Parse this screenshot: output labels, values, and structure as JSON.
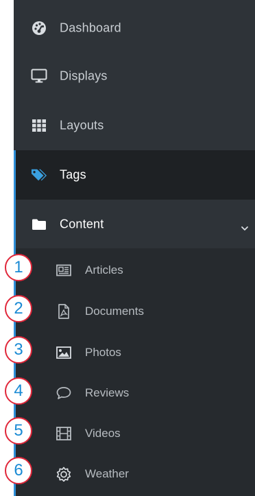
{
  "nav": {
    "items": [
      {
        "label": "Dashboard",
        "icon": "dashboard-gauge-icon"
      },
      {
        "label": "Displays",
        "icon": "monitor-icon"
      },
      {
        "label": "Layouts",
        "icon": "grid-icon"
      },
      {
        "label": "Tags",
        "icon": "tags-icon",
        "active": true
      },
      {
        "label": "Content",
        "icon": "folder-icon",
        "expanded": true
      }
    ],
    "content_submenu": [
      {
        "label": "Articles",
        "icon": "newspaper-icon"
      },
      {
        "label": "Documents",
        "icon": "pdf-file-icon"
      },
      {
        "label": "Photos",
        "icon": "image-icon"
      },
      {
        "label": "Reviews",
        "icon": "comment-icon"
      },
      {
        "label": "Videos",
        "icon": "film-icon"
      },
      {
        "label": "Weather",
        "icon": "sun-icon"
      }
    ]
  },
  "badges": [
    "1",
    "2",
    "3",
    "4",
    "5",
    "6"
  ],
  "colors": {
    "sidebar_bg": "#2e3338",
    "active_bg": "#1e2124",
    "submenu_bg": "#262a2e",
    "accent": "#2f8fd8",
    "badge_border": "#e0273a",
    "badge_text": "#1a8ad4",
    "tag_icon": "#3aa0e0"
  }
}
